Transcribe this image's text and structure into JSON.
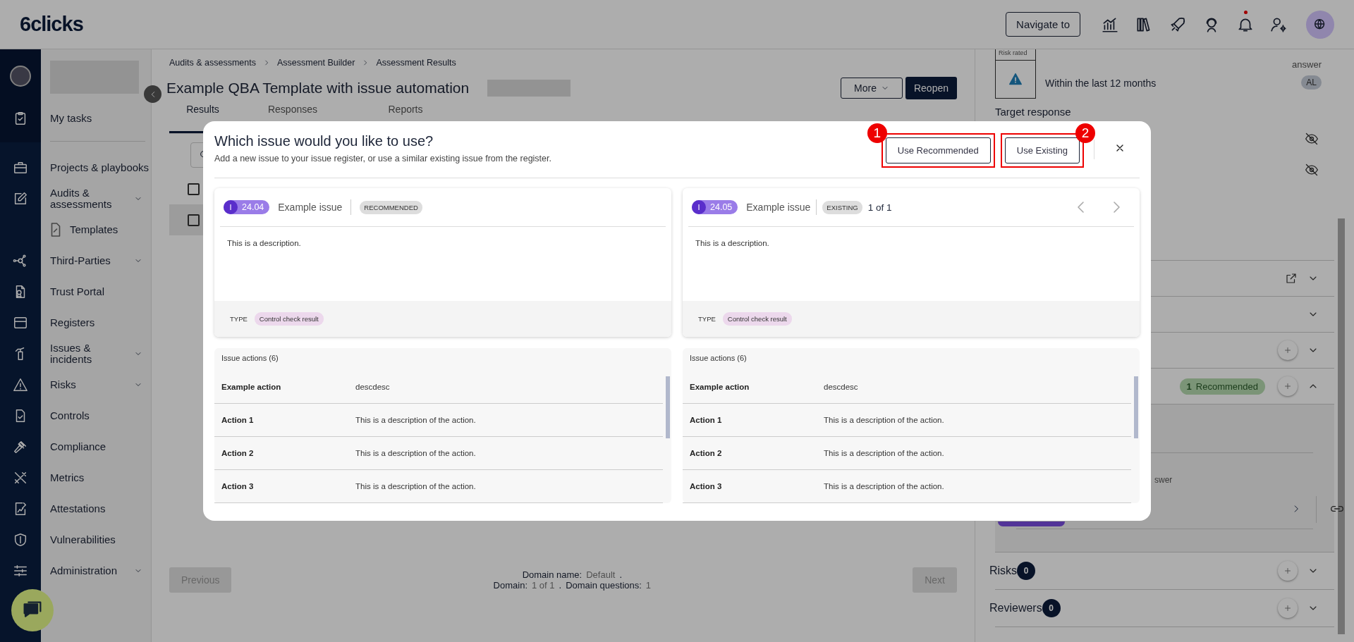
{
  "header": {
    "logo": "6clicks",
    "navigate_button": "Navigate to",
    "notification": true
  },
  "sidebar": {
    "top_item": "My tasks",
    "items": [
      {
        "label": "Projects & playbooks",
        "expandable": false
      },
      {
        "label": "Audits & assessments",
        "expandable": true,
        "children": [
          {
            "label": "Templates",
            "expandable": false
          }
        ]
      },
      {
        "label": "Third-Parties",
        "expandable": true
      },
      {
        "label": "Trust Portal",
        "expandable": false
      },
      {
        "label": "Registers",
        "expandable": false
      },
      {
        "label": "Issues & incidents",
        "expandable": true
      },
      {
        "label": "Risks",
        "expandable": true
      },
      {
        "label": "Controls",
        "expandable": false
      },
      {
        "label": "Compliance",
        "expandable": false
      },
      {
        "label": "Metrics",
        "expandable": false
      },
      {
        "label": "Attestations",
        "expandable": false
      },
      {
        "label": "Vulnerabilities",
        "expandable": false
      },
      {
        "label": "Administration",
        "expandable": true
      }
    ]
  },
  "breadcrumbs": [
    "Audits & assessments",
    "Assessment Builder",
    "Assessment Results"
  ],
  "page_title": "Example QBA Template with issue automation",
  "page_actions": [
    {
      "label": "More",
      "kind": "dropdown"
    },
    {
      "label": "Reopen",
      "kind": "primary"
    }
  ],
  "tabs": [
    {
      "label": "Results",
      "selected": true
    },
    {
      "label": "Responses",
      "selected": false
    },
    {
      "label": "Reports",
      "selected": false
    }
  ],
  "table_rows": [
    {
      "checked": false,
      "selected": false
    },
    {
      "checked": false,
      "selected": true
    }
  ],
  "pager": {
    "previous": "Previous",
    "next": "Next",
    "domain_name_label": "Domain name:",
    "domain_name": "Default",
    "separator": ".",
    "domain_label": "Domain:",
    "domain": "1 of 1",
    "questions_label": "Domain questions:",
    "questions": "1"
  },
  "side_panel": {
    "risk_rated_label": "Risk rated",
    "frequency": "Within the last 12 months",
    "answer_label": "answer",
    "assignee": "AL",
    "target_label": "Target response",
    "sections": [
      {
        "kind": "link",
        "expanded": false
      },
      {
        "kind": "plain",
        "expanded": false
      },
      {
        "kind": "add",
        "expanded": false
      },
      {
        "kind": "add",
        "expanded": true,
        "badge_count": "1",
        "badge": "Recommended",
        "partial_label": "swer"
      }
    ],
    "counters": [
      {
        "label": "Risks",
        "count": "0"
      },
      {
        "label": "Reviewers",
        "count": "0"
      }
    ]
  },
  "modal": {
    "title": "Which issue would you like to use?",
    "subtitle": "Add a new issue to your issue register, or use a similar existing issue from the register.",
    "buttons": [
      {
        "label": "Use Recommended",
        "callout": "1"
      },
      {
        "label": "Use Existing",
        "callout": "2"
      }
    ],
    "cards": [
      {
        "prefix": "I",
        "issue_id": "24.04",
        "title": "Example issue",
        "tag": "RECOMMENDED",
        "description": "This is a description.",
        "type_label": "TYPE",
        "type": "Control check result",
        "actions_title": "Issue actions (6)",
        "actions": [
          {
            "name": "Example action",
            "description": "descdesc"
          },
          {
            "name": "Action 1",
            "description": "This is a description of the action."
          },
          {
            "name": "Action 2",
            "description": "This is a description of the action."
          },
          {
            "name": "Action 3",
            "description": "This is a description of the action."
          }
        ]
      },
      {
        "prefix": "I",
        "issue_id": "24.05",
        "title": "Example issue",
        "tag": "EXISTING",
        "counter": "1 of 1",
        "description": "This is a description.",
        "type_label": "TYPE",
        "type": "Control check result",
        "actions_title": "Issue actions (6)",
        "actions": [
          {
            "name": "Example action",
            "description": "descdesc"
          },
          {
            "name": "Action 1",
            "description": "This is a description of the action."
          },
          {
            "name": "Action 2",
            "description": "This is a description of the action."
          },
          {
            "name": "Action 3",
            "description": "This is a description of the action."
          }
        ]
      }
    ]
  }
}
